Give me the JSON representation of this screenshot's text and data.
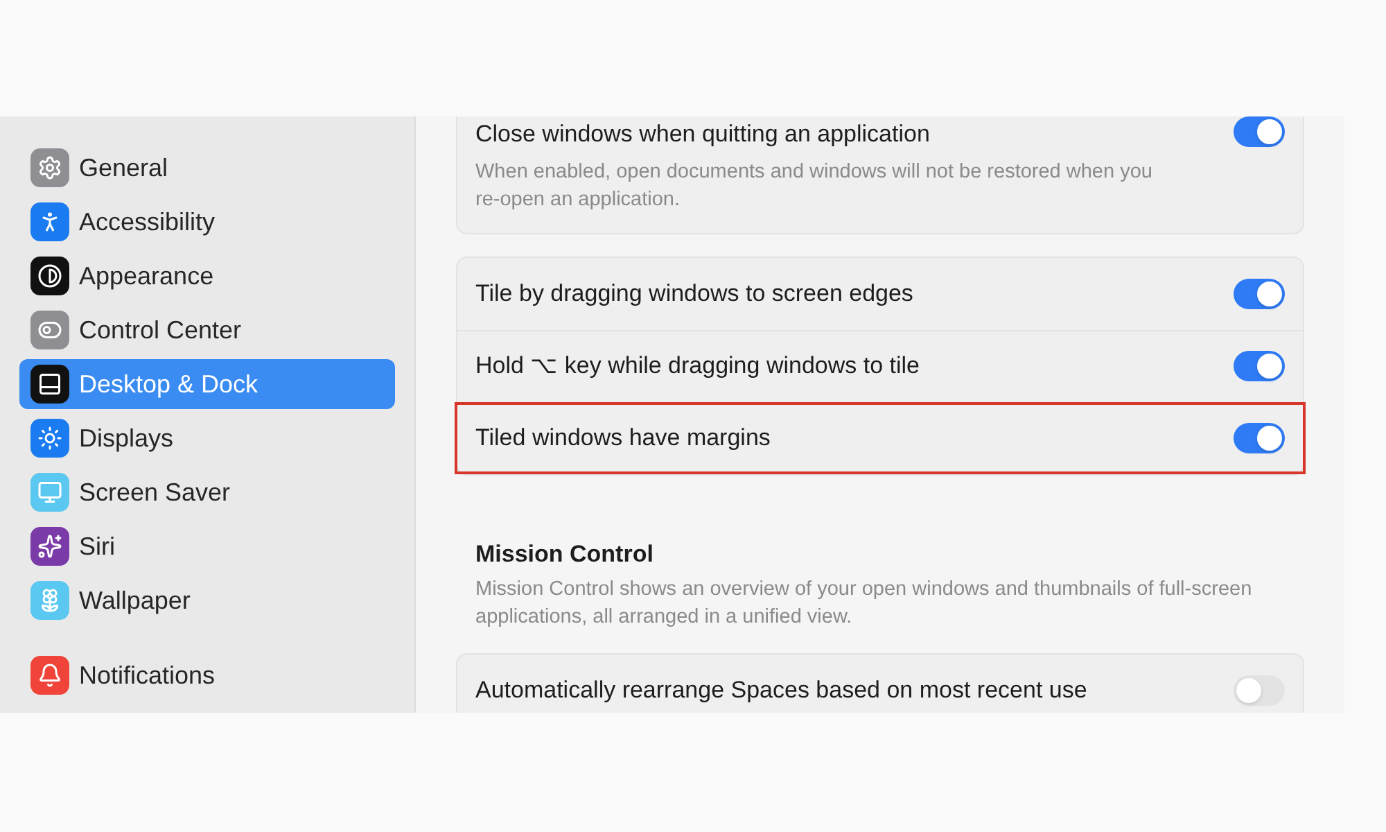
{
  "sidebar": {
    "sections": [
      [
        {
          "label": "General",
          "selected": false
        },
        {
          "label": "Accessibility",
          "selected": false
        },
        {
          "label": "Appearance",
          "selected": false
        },
        {
          "label": "Control Center",
          "selected": false
        },
        {
          "label": "Desktop & Dock",
          "selected": true
        },
        {
          "label": "Displays",
          "selected": false
        },
        {
          "label": "Screen Saver",
          "selected": false
        },
        {
          "label": "Siri",
          "selected": false
        },
        {
          "label": "Wallpaper",
          "selected": false
        }
      ],
      [
        {
          "label": "Notifications",
          "selected": false
        }
      ]
    ]
  },
  "content": {
    "groups": [
      {
        "rows": [
          {
            "title": "Close windows when quitting an application",
            "description": "When enabled, open documents and windows will not be restored when you re-open an application.",
            "on": true,
            "highlighted": false
          }
        ]
      },
      {
        "rows": [
          {
            "title": "Tile by dragging windows to screen edges",
            "on": true,
            "highlighted": false
          },
          {
            "title": "Hold ⌥ key while dragging windows to tile",
            "on": true,
            "highlighted": false
          },
          {
            "title": "Tiled windows have margins",
            "on": true,
            "highlighted": true
          }
        ]
      },
      {
        "heading": "Mission Control",
        "description": "Mission Control shows an overview of your open windows and thumbnails of full-screen applications, all arranged in a unified view.",
        "rows": [
          {
            "title": "Automatically rearrange Spaces based on most recent use",
            "on": false,
            "highlighted": false
          }
        ]
      }
    ]
  }
}
